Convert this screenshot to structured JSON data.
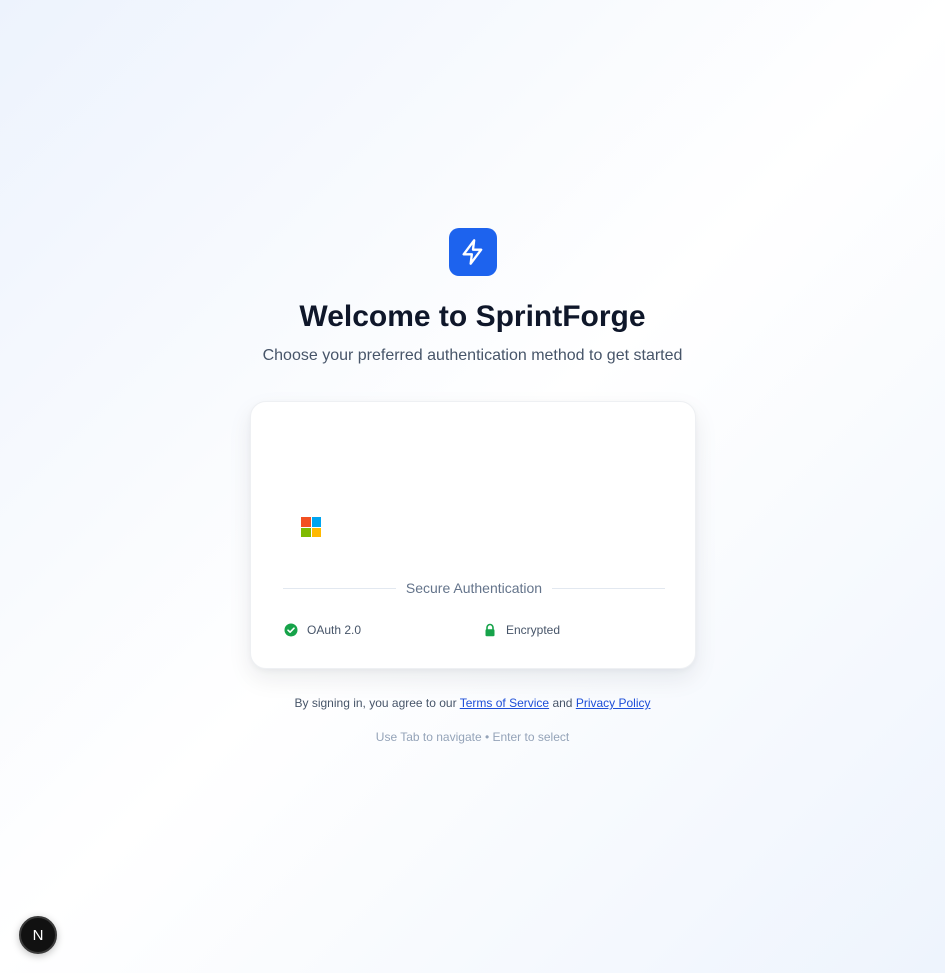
{
  "app": {
    "logo_icon": "lightning-bolt-icon",
    "brand_color": "#1d63ee",
    "title": "Welcome to SprintForge",
    "subtitle": "Choose your preferred authentication method to get started"
  },
  "card": {
    "microsoft_button_icon": "microsoft-logo-icon",
    "divider_label": "Secure Authentication",
    "features": [
      {
        "icon": "check-circle-icon",
        "label": "OAuth 2.0",
        "color": "#16a34a"
      },
      {
        "icon": "lock-icon",
        "label": "Encrypted",
        "color": "#16a34a"
      }
    ]
  },
  "legal": {
    "prefix": "By signing in, you agree to our",
    "terms_link": "Terms of Service",
    "conjunction": "and",
    "privacy_link": "Privacy Policy"
  },
  "hint": "Use Tab to navigate • Enter to select",
  "dev_badge": {
    "label": "N",
    "icon": "nextjs-logo-icon"
  },
  "colors": {
    "microsoft": [
      "#f25022",
      "#00a4ef",
      "#7fba00",
      "#ffb900"
    ],
    "link": "#1d4ed8"
  }
}
